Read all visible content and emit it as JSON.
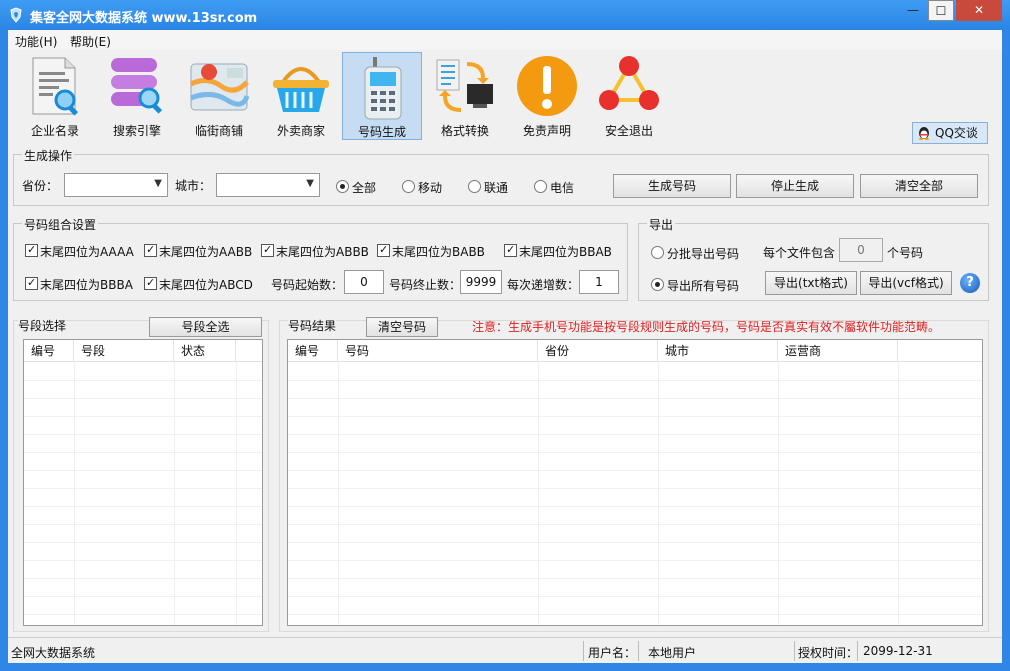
{
  "window": {
    "title": "集客全网大数据系统   www.13sr.com",
    "min": "—",
    "max": "☐",
    "close": "✕"
  },
  "menu": [
    {
      "label": "功能(H)"
    },
    {
      "label": "帮助(E)"
    }
  ],
  "toolbar": [
    {
      "label": "企业名录",
      "icon": "document-search-icon"
    },
    {
      "label": "搜索引擎",
      "icon": "database-search-icon"
    },
    {
      "label": "临街商铺",
      "icon": "map-icon"
    },
    {
      "label": "外卖商家",
      "icon": "basket-icon"
    },
    {
      "label": "号码生成",
      "icon": "phone-icon",
      "selected": true
    },
    {
      "label": "格式转换",
      "icon": "convert-icon"
    },
    {
      "label": "免责声明",
      "icon": "warning-icon"
    },
    {
      "label": "安全退出",
      "icon": "exit-icon"
    }
  ],
  "qq": {
    "label": "QQ交谈"
  },
  "generate": {
    "title": "生成操作",
    "province_label": "省份：",
    "province_value": "",
    "city_label": "城市：",
    "city_value": "",
    "carriers": [
      {
        "label": "全部",
        "checked": true
      },
      {
        "label": "移动",
        "checked": false
      },
      {
        "label": "联通",
        "checked": false
      },
      {
        "label": "电信",
        "checked": false
      }
    ],
    "buttons": {
      "generate": "生成号码",
      "stop": "停止生成",
      "clear_all": "清空全部"
    }
  },
  "combo": {
    "title": "号码组合设置",
    "checks": [
      {
        "label": "末尾四位为AAAA",
        "checked": true
      },
      {
        "label": "末尾四位为AABB",
        "checked": true
      },
      {
        "label": "末尾四位为ABBB",
        "checked": true
      },
      {
        "label": "末尾四位为BABB",
        "checked": true
      },
      {
        "label": "末尾四位为BBAB",
        "checked": true
      },
      {
        "label": "末尾四位为BBBA",
        "checked": true
      },
      {
        "label": "末尾四位为ABCD",
        "checked": true
      }
    ],
    "start_label": "号码起始数：",
    "start_value": "0",
    "end_label": "号码终止数：",
    "end_value": "9999",
    "step_label": "每次递增数：",
    "step_value": "1"
  },
  "export": {
    "title": "导出",
    "batch_label": "分批导出号码",
    "per_file_label": "每个文件包含",
    "per_file_value": "0",
    "per_file_unit": "个号码",
    "all_label": "导出所有号码",
    "txt_button": "导出(txt格式)",
    "vcf_button": "导出(vcf格式)",
    "help": "?"
  },
  "segment": {
    "title": "号段选择",
    "select_all": "号段全选",
    "columns": [
      "编号",
      "号段",
      "状态"
    ]
  },
  "results": {
    "title": "号码结果",
    "clear": "清空号码",
    "notice": "注意：生成手机号功能是按号段规则生成的号码，号码是否真实有效不屬软件功能范畴。",
    "columns": [
      "编号",
      "号码",
      "省份",
      "城市",
      "运营商"
    ]
  },
  "status": {
    "app": "全网大数据系统",
    "user_label": "用户名：",
    "user_value": "本地用户",
    "auth_label": "授权时间：",
    "auth_value": "2099-12-31"
  }
}
